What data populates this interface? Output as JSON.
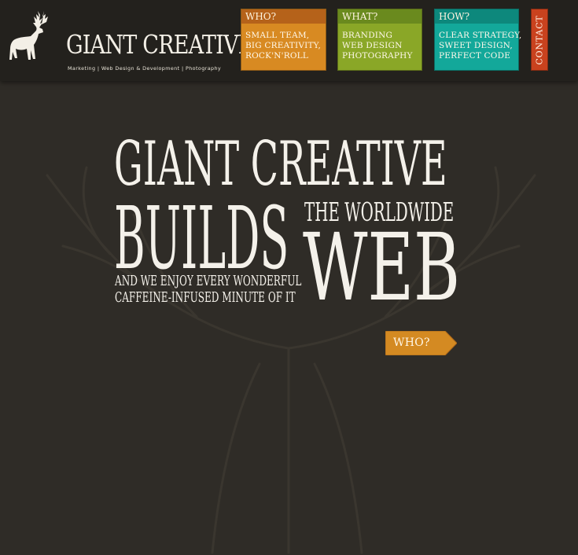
{
  "brand": {
    "title": "GIANT CREATIVE",
    "tagline": "Marketing | Web Design & Development | Photography"
  },
  "nav": {
    "who": {
      "heading": "WHO?",
      "lines": [
        "SMALL TEAM,",
        "BIG CREATIVITY,",
        "ROCK'N'ROLL"
      ]
    },
    "what": {
      "heading": "WHAT?",
      "lines": [
        "BRANDING",
        "WEB DESIGN",
        "PHOTOGRAPHY"
      ]
    },
    "how": {
      "heading": "HOW?",
      "lines": [
        "CLEAR STRATEGY,",
        "SWEET DESIGN,",
        "PERFECT CODE"
      ]
    },
    "contact": "CONTACT"
  },
  "hero": {
    "line1": "GIANT CREATIVE",
    "line2": "BUILDS",
    "line3": "THE WORLDWIDE",
    "line4": "WEB",
    "line5": "AND WE ENJOY EVERY WONDERFUL",
    "line6": "CAFFEINE-INFUSED MINUTE OF IT"
  },
  "cta": {
    "label": "WHO?"
  },
  "colors": {
    "background": "#2f2c27",
    "header": "#23211d",
    "who": "#d88a22",
    "what": "#8aa727",
    "how": "#13a89a",
    "contact": "#c9421e",
    "cta": "#d48a22"
  }
}
